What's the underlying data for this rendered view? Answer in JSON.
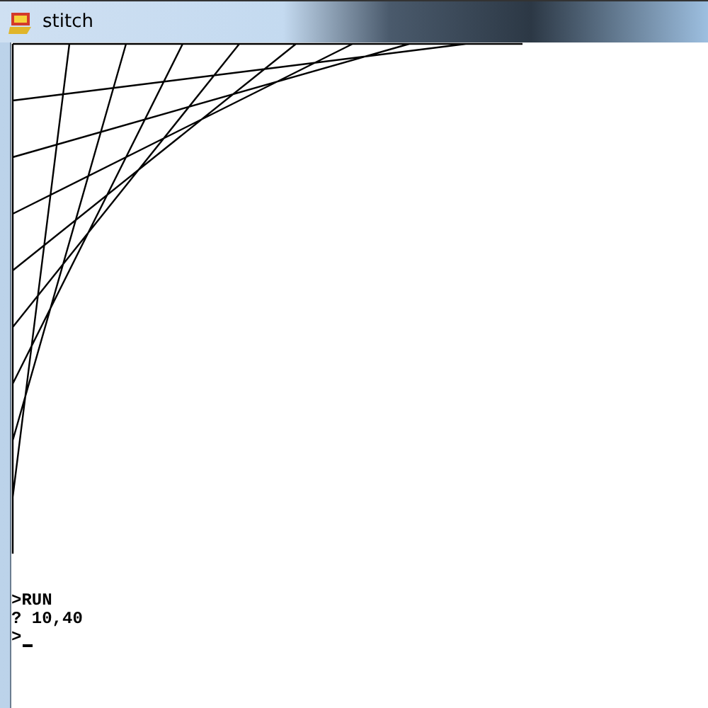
{
  "window": {
    "title": "stitch"
  },
  "console": {
    "lines": [
      ">RUN",
      "? 10,40"
    ],
    "prompt": ">"
  }
}
